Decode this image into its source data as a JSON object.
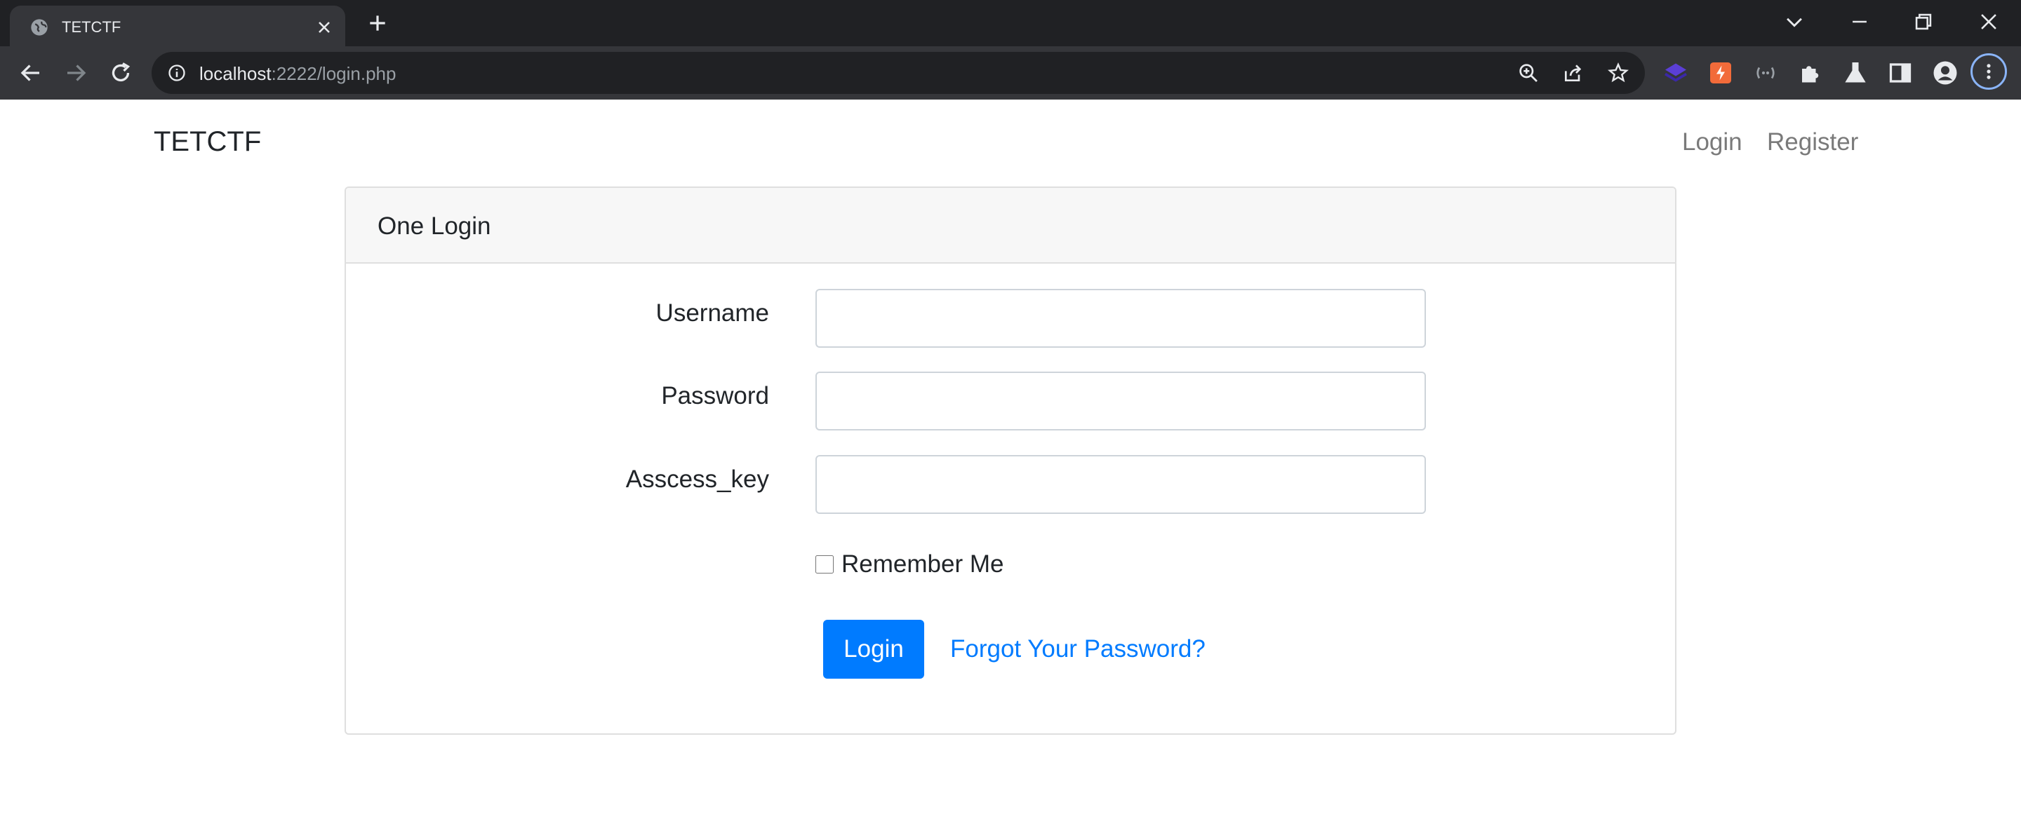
{
  "browser": {
    "tab": {
      "title": "TETCTF"
    },
    "url": {
      "host": "localhost",
      "rest": ":2222/login.php"
    }
  },
  "navbar": {
    "brand": "TETCTF",
    "links": [
      {
        "label": "Login"
      },
      {
        "label": "Register"
      }
    ]
  },
  "card": {
    "header": "One Login",
    "fields": [
      {
        "label": "Username",
        "value": ""
      },
      {
        "label": "Password",
        "value": ""
      },
      {
        "label": "Asscess_key",
        "value": ""
      }
    ],
    "remember": {
      "label": "Remember Me",
      "checked": false
    },
    "login_button": "Login",
    "forgot_link": "Forgot Your Password?"
  },
  "colors": {
    "primary": "#007bff",
    "chrome_dark": "#202124",
    "chrome_toolbar": "#35363a"
  }
}
